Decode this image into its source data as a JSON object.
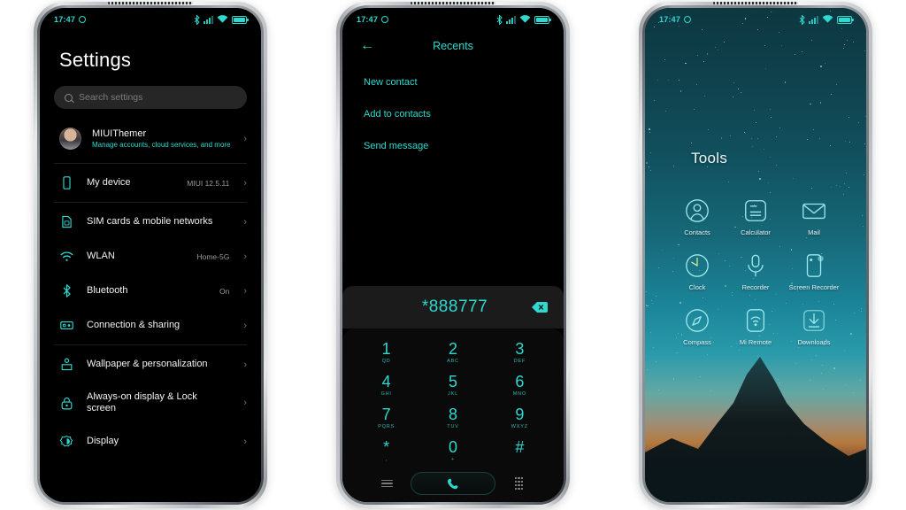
{
  "statusbar": {
    "time": "17:47",
    "alarm_icon": "alarm-icon",
    "bluetooth_icon": "bluetooth-icon",
    "signal_icon": "signal-bars-icon",
    "wifi_icon": "wifi-icon",
    "battery_icon": "battery-icon"
  },
  "theme": {
    "accent": "#2fd9d0",
    "background": "#000000",
    "surface": "#1b1b1b",
    "text_primary": "#f2f2f2",
    "text_secondary": "#9a9a9a"
  },
  "phone1": {
    "title": "Settings",
    "search": {
      "placeholder": "Search settings",
      "icon": "search-icon"
    },
    "account": {
      "name": "MIUIThemer",
      "subtitle": "Manage accounts, cloud services, and more",
      "avatar": "user-avatar",
      "chevron": "›"
    },
    "rows": [
      {
        "label": "My device",
        "value": "MIUI 12.5.11",
        "icon": "device-icon",
        "chevron": "›"
      },
      {
        "label": "SIM cards & mobile networks",
        "value": "",
        "icon": "sim-card-icon",
        "chevron": "›"
      },
      {
        "label": "WLAN",
        "value": "Home-5G",
        "icon": "wifi-icon",
        "chevron": "›"
      },
      {
        "label": "Bluetooth",
        "value": "On",
        "icon": "bluetooth-icon",
        "chevron": "›"
      },
      {
        "label": "Connection & sharing",
        "value": "",
        "icon": "connection-sharing-icon",
        "chevron": "›"
      },
      {
        "label": "Wallpaper & personalization",
        "value": "",
        "icon": "wallpaper-icon",
        "chevron": "›"
      },
      {
        "label": "Always-on display & Lock screen",
        "value": "",
        "icon": "lock-icon",
        "chevron": "›"
      },
      {
        "label": "Display",
        "value": "",
        "icon": "display-brightness-icon",
        "chevron": "›"
      }
    ]
  },
  "phone2": {
    "header": {
      "title": "Recents",
      "back_icon": "back-arrow-icon"
    },
    "actions": [
      "New contact",
      "Add to contacts",
      "Send message"
    ],
    "number": "*888777",
    "backspace_icon": "backspace-icon",
    "keys": [
      {
        "digit": "1",
        "sub": "QD"
      },
      {
        "digit": "2",
        "sub": "ABC"
      },
      {
        "digit": "3",
        "sub": "DEF"
      },
      {
        "digit": "4",
        "sub": "GHI"
      },
      {
        "digit": "5",
        "sub": "JKL"
      },
      {
        "digit": "6",
        "sub": "MNO"
      },
      {
        "digit": "7",
        "sub": "PQRS"
      },
      {
        "digit": "8",
        "sub": "TUV"
      },
      {
        "digit": "9",
        "sub": "WXYZ"
      },
      {
        "digit": "*",
        "sub": ","
      },
      {
        "digit": "0",
        "sub": "+"
      },
      {
        "digit": "#",
        "sub": ""
      }
    ],
    "bottom": {
      "menu_icon": "hamburger-menu-icon",
      "call_icon": "call-handset-icon",
      "keypad_icon": "keypad-grid-icon"
    }
  },
  "phone3": {
    "folder_title": "Tools",
    "apps": [
      {
        "name": "Contacts",
        "icon": "contacts-icon"
      },
      {
        "name": "Calculator",
        "icon": "calculator-icon"
      },
      {
        "name": "Mail",
        "icon": "mail-envelope-icon"
      },
      {
        "name": "Clock",
        "icon": "clock-icon"
      },
      {
        "name": "Recorder",
        "icon": "microphone-icon"
      },
      {
        "name": "Screen Recorder",
        "icon": "screen-recorder-icon"
      },
      {
        "name": "Compass",
        "icon": "compass-icon"
      },
      {
        "name": "Mi Remote",
        "icon": "mi-remote-icon"
      },
      {
        "name": "Downloads",
        "icon": "downloads-icon"
      }
    ]
  }
}
